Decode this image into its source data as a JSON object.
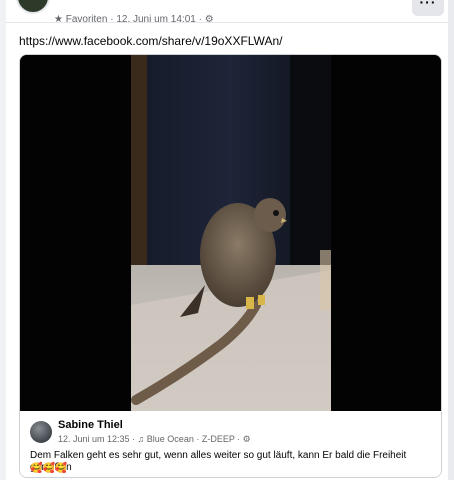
{
  "header": {
    "meta_text": "★ Favoriten · 12. Juni um 14:01 · ⚙",
    "more_label": "···"
  },
  "post": {
    "text": "https://www.facebook.com/share/v/19oXXFLWAn/"
  },
  "shared": {
    "author": "Sabine Thiel",
    "meta": "12. Juni um 12:35 · ♫ Blue Ocean · Z-DEEP · ⚙",
    "text": "Dem Falken geht es sehr gut, wenn alles weiter so gut läuft, kann Er bald die Freiheit genießen",
    "emojis": "🥰🥰🥰"
  },
  "icons": [
    "more-icon",
    "video-thumbnail",
    "avatar"
  ]
}
